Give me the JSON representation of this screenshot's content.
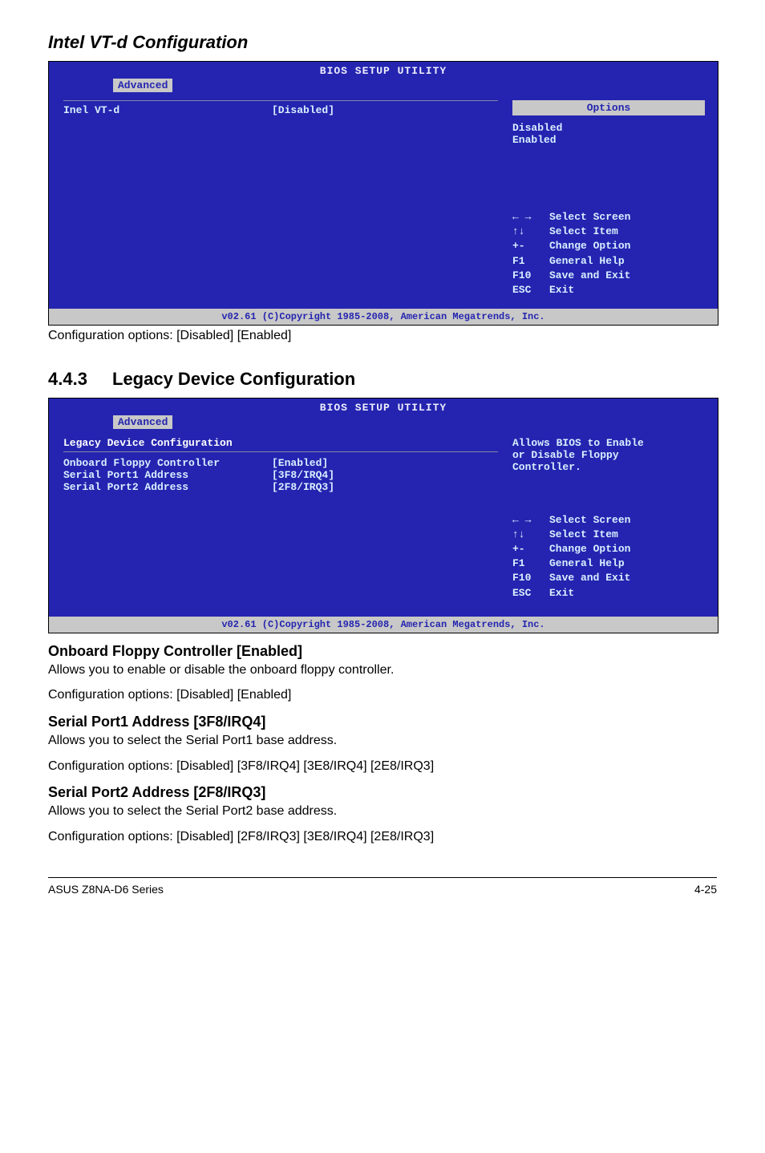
{
  "titles": {
    "t1": "Intel VT-d Configuration",
    "section_num": "4.4.3",
    "section_txt": "Legacy Device Configuration"
  },
  "bios_common": {
    "header": "BIOS SETUP UTILITY",
    "tab": "Advanced",
    "footer": "v02.61 (C)Copyright 1985-2008, American Megatrends, Inc.",
    "keys": {
      "arrows": "←  →",
      "arrows_d": "Select Screen",
      "updown": "↑↓",
      "updown_d": "Select Item",
      "pm": "+-",
      "pm_d": "Change Option",
      "f1": "F1",
      "f1_d": "General Help",
      "f10": "F10",
      "f10_d": "Save and Exit",
      "esc": "ESC",
      "esc_d": "Exit"
    }
  },
  "bios1": {
    "item_label": "Inel VT-d",
    "item_value": "[Disabled]",
    "right_title": "Options",
    "opt1": "Disabled",
    "opt2": "Enabled"
  },
  "p_after_bios1": "Configuration options: [Disabled] [Enabled]",
  "bios2": {
    "heading": "Legacy Device Configuration",
    "r1_l": "Onboard Floppy Controller",
    "r1_v": "[Enabled]",
    "r2_l": "Serial Port1 Address",
    "r2_v": "[3F8/IRQ4]",
    "r3_l": "Serial Port2 Address",
    "r3_v": "[2F8/IRQ3]",
    "help1": "Allows BIOS to Enable",
    "help2": "or Disable Floppy",
    "help3": "Controller."
  },
  "sub1": {
    "h": "Onboard Floppy Controller [Enabled]",
    "p1": "Allows you to enable or disable the onboard floppy controller.",
    "p2": "Configuration options: [Disabled] [Enabled]"
  },
  "sub2": {
    "h": "Serial Port1 Address [3F8/IRQ4]",
    "p1": "Allows you to select the Serial Port1 base address.",
    "p2": "Configuration options: [Disabled] [3F8/IRQ4] [3E8/IRQ4] [2E8/IRQ3]"
  },
  "sub3": {
    "h": "Serial Port2 Address [2F8/IRQ3]",
    "p1": "Allows you to select the Serial Port2 base address.",
    "p2": "Configuration options: [Disabled] [2F8/IRQ3] [3E8/IRQ4] [2E8/IRQ3]"
  },
  "footer": {
    "left": "ASUS Z8NA-D6 Series",
    "right": "4-25"
  }
}
